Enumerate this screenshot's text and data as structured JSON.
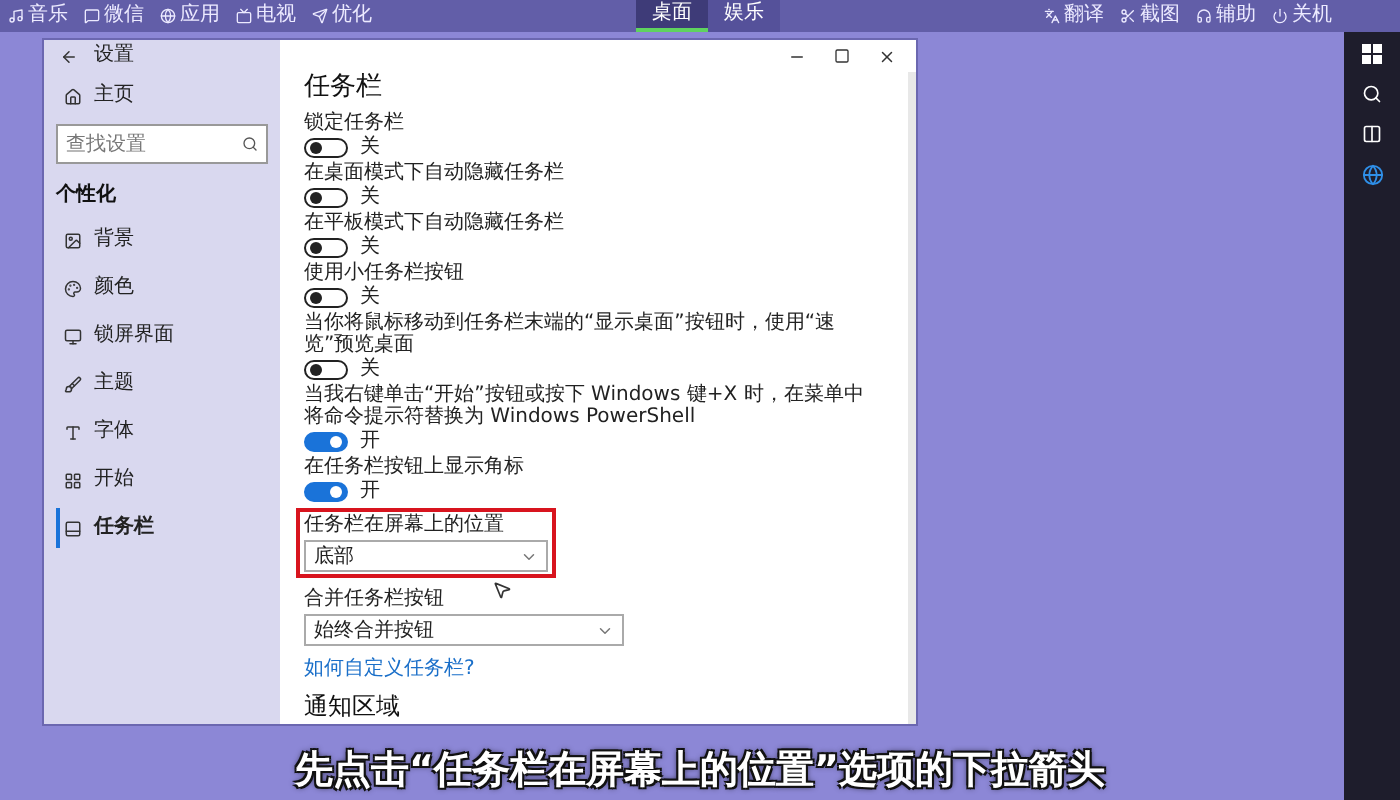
{
  "top_bar": {
    "left_items": [
      "音乐",
      "微信",
      "应用",
      "电视",
      "优化"
    ],
    "center_tabs": [
      {
        "label": "桌面",
        "selected": true
      },
      {
        "label": "娱乐",
        "selected": false
      }
    ],
    "right_items": [
      "翻译",
      "截图",
      "辅助",
      "关机"
    ]
  },
  "window": {
    "title": "设置"
  },
  "sidebar": {
    "home": "主页",
    "search": {
      "placeholder": "查找设置"
    },
    "section": "个性化",
    "items": [
      {
        "label": "背景",
        "selected": false
      },
      {
        "label": "颜色",
        "selected": false
      },
      {
        "label": "锁屏界面",
        "selected": false
      },
      {
        "label": "主题",
        "selected": false
      },
      {
        "label": "字体",
        "selected": false
      },
      {
        "label": "开始",
        "selected": false
      },
      {
        "label": "任务栏",
        "selected": true
      }
    ]
  },
  "main": {
    "title": "任务栏",
    "settings": [
      {
        "kind": "toggle",
        "label": "锁定任务栏",
        "on": false,
        "state_label": "关"
      },
      {
        "kind": "toggle",
        "label": "在桌面模式下自动隐藏任务栏",
        "on": false,
        "state_label": "关"
      },
      {
        "kind": "toggle",
        "label": "在平板模式下自动隐藏任务栏",
        "on": false,
        "state_label": "关"
      },
      {
        "kind": "toggle",
        "label": "使用小任务栏按钮",
        "on": false,
        "state_label": "关"
      },
      {
        "kind": "toggle",
        "label": "当你将鼠标移动到任务栏末端的“显示桌面”按钮时，使用“速览”预览桌面",
        "on": false,
        "state_label": "关"
      },
      {
        "kind": "toggle",
        "label": "当我右键单击“开始”按钮或按下 Windows 键+X 时，在菜单中将命令提示符替换为 Windows PowerShell",
        "on": true,
        "state_label": "开"
      },
      {
        "kind": "toggle",
        "label": "在任务栏按钮上显示角标",
        "on": true,
        "state_label": "开"
      },
      {
        "kind": "dropdown",
        "label": "任务栏在屏幕上的位置",
        "value": "底部",
        "highlighted": true
      },
      {
        "kind": "dropdown",
        "label": "合并任务栏按钮",
        "value": "始终合并按钮",
        "highlighted": false
      },
      {
        "kind": "link",
        "label": "如何自定义任务栏?"
      },
      {
        "kind": "heading",
        "label": "通知区域"
      }
    ]
  },
  "caption": "先点击“任务栏在屏幕上的位置”选项的下拉箭头"
}
